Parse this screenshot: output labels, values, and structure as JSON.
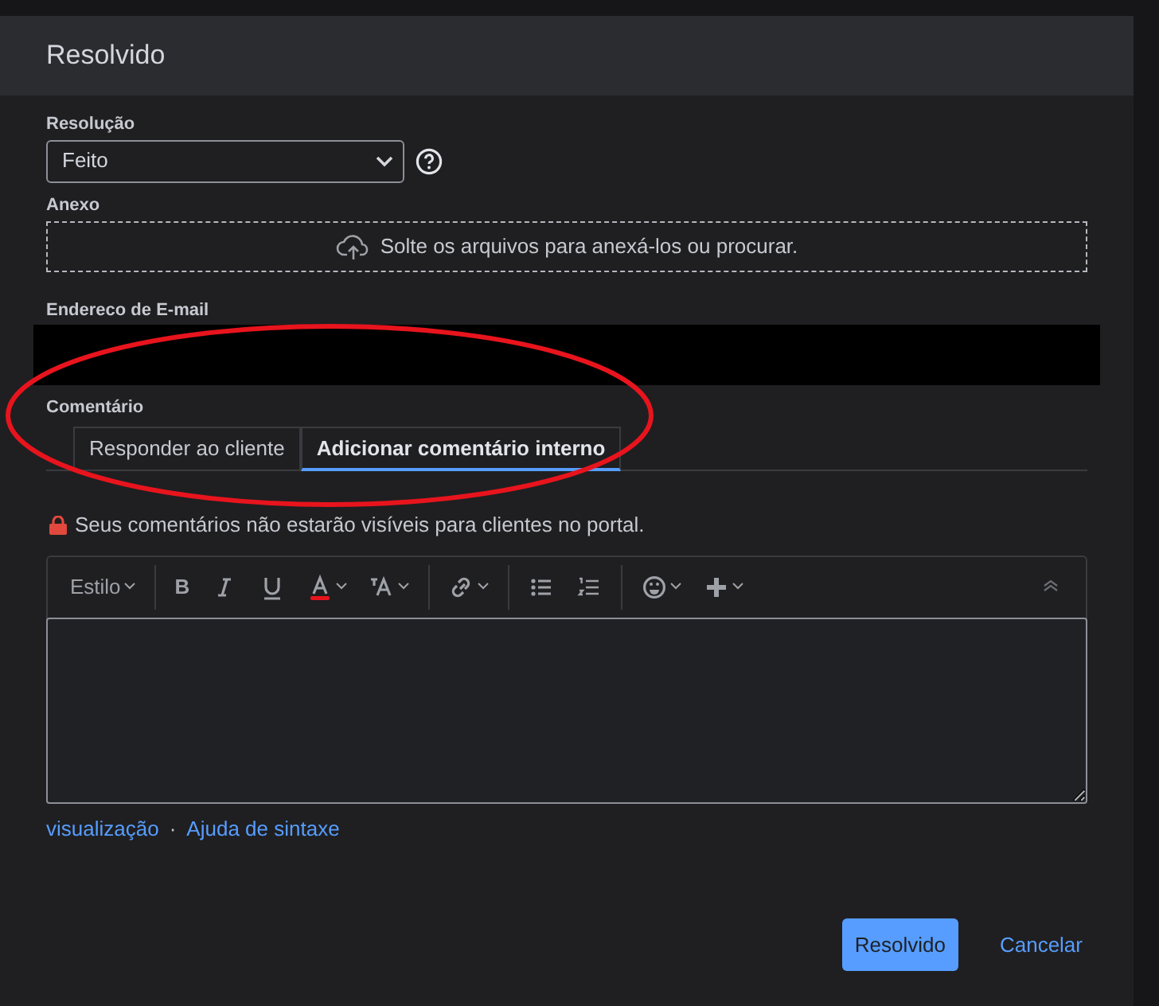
{
  "dialog": {
    "title": "Resolvido"
  },
  "resolution": {
    "label": "Resolução",
    "value": "Feito"
  },
  "attachment": {
    "label": "Anexo",
    "dropzone_text": "Solte os arquivos para anexá-los ou procurar."
  },
  "email": {
    "label": "Endereco de E-mail"
  },
  "comment": {
    "label": "Comentário",
    "tabs": [
      {
        "label": "Responder ao cliente",
        "selected": false
      },
      {
        "label": "Adicionar comentário interno",
        "selected": true
      }
    ],
    "notice": "Seus comentários não estarão visíveis para clientes no portal.",
    "toolbar": [
      {
        "kind": "style",
        "label": "Estilo"
      },
      {
        "kind": "sep"
      },
      {
        "kind": "bold",
        "label": "B"
      },
      {
        "kind": "italic"
      },
      {
        "kind": "underline"
      },
      {
        "kind": "color"
      },
      {
        "kind": "format"
      },
      {
        "kind": "sep"
      },
      {
        "kind": "link"
      },
      {
        "kind": "sep"
      },
      {
        "kind": "bullets"
      },
      {
        "kind": "numbers"
      },
      {
        "kind": "sep"
      },
      {
        "kind": "emoji"
      },
      {
        "kind": "plus"
      },
      {
        "kind": "collapse"
      }
    ],
    "links": [
      "visualização",
      "Ajuda de sintaxe"
    ],
    "link_separator": "·"
  },
  "buttons": [
    {
      "kind": "primary",
      "label": "Resolvido"
    },
    {
      "kind": "link",
      "label": "Cancelar"
    }
  ]
}
